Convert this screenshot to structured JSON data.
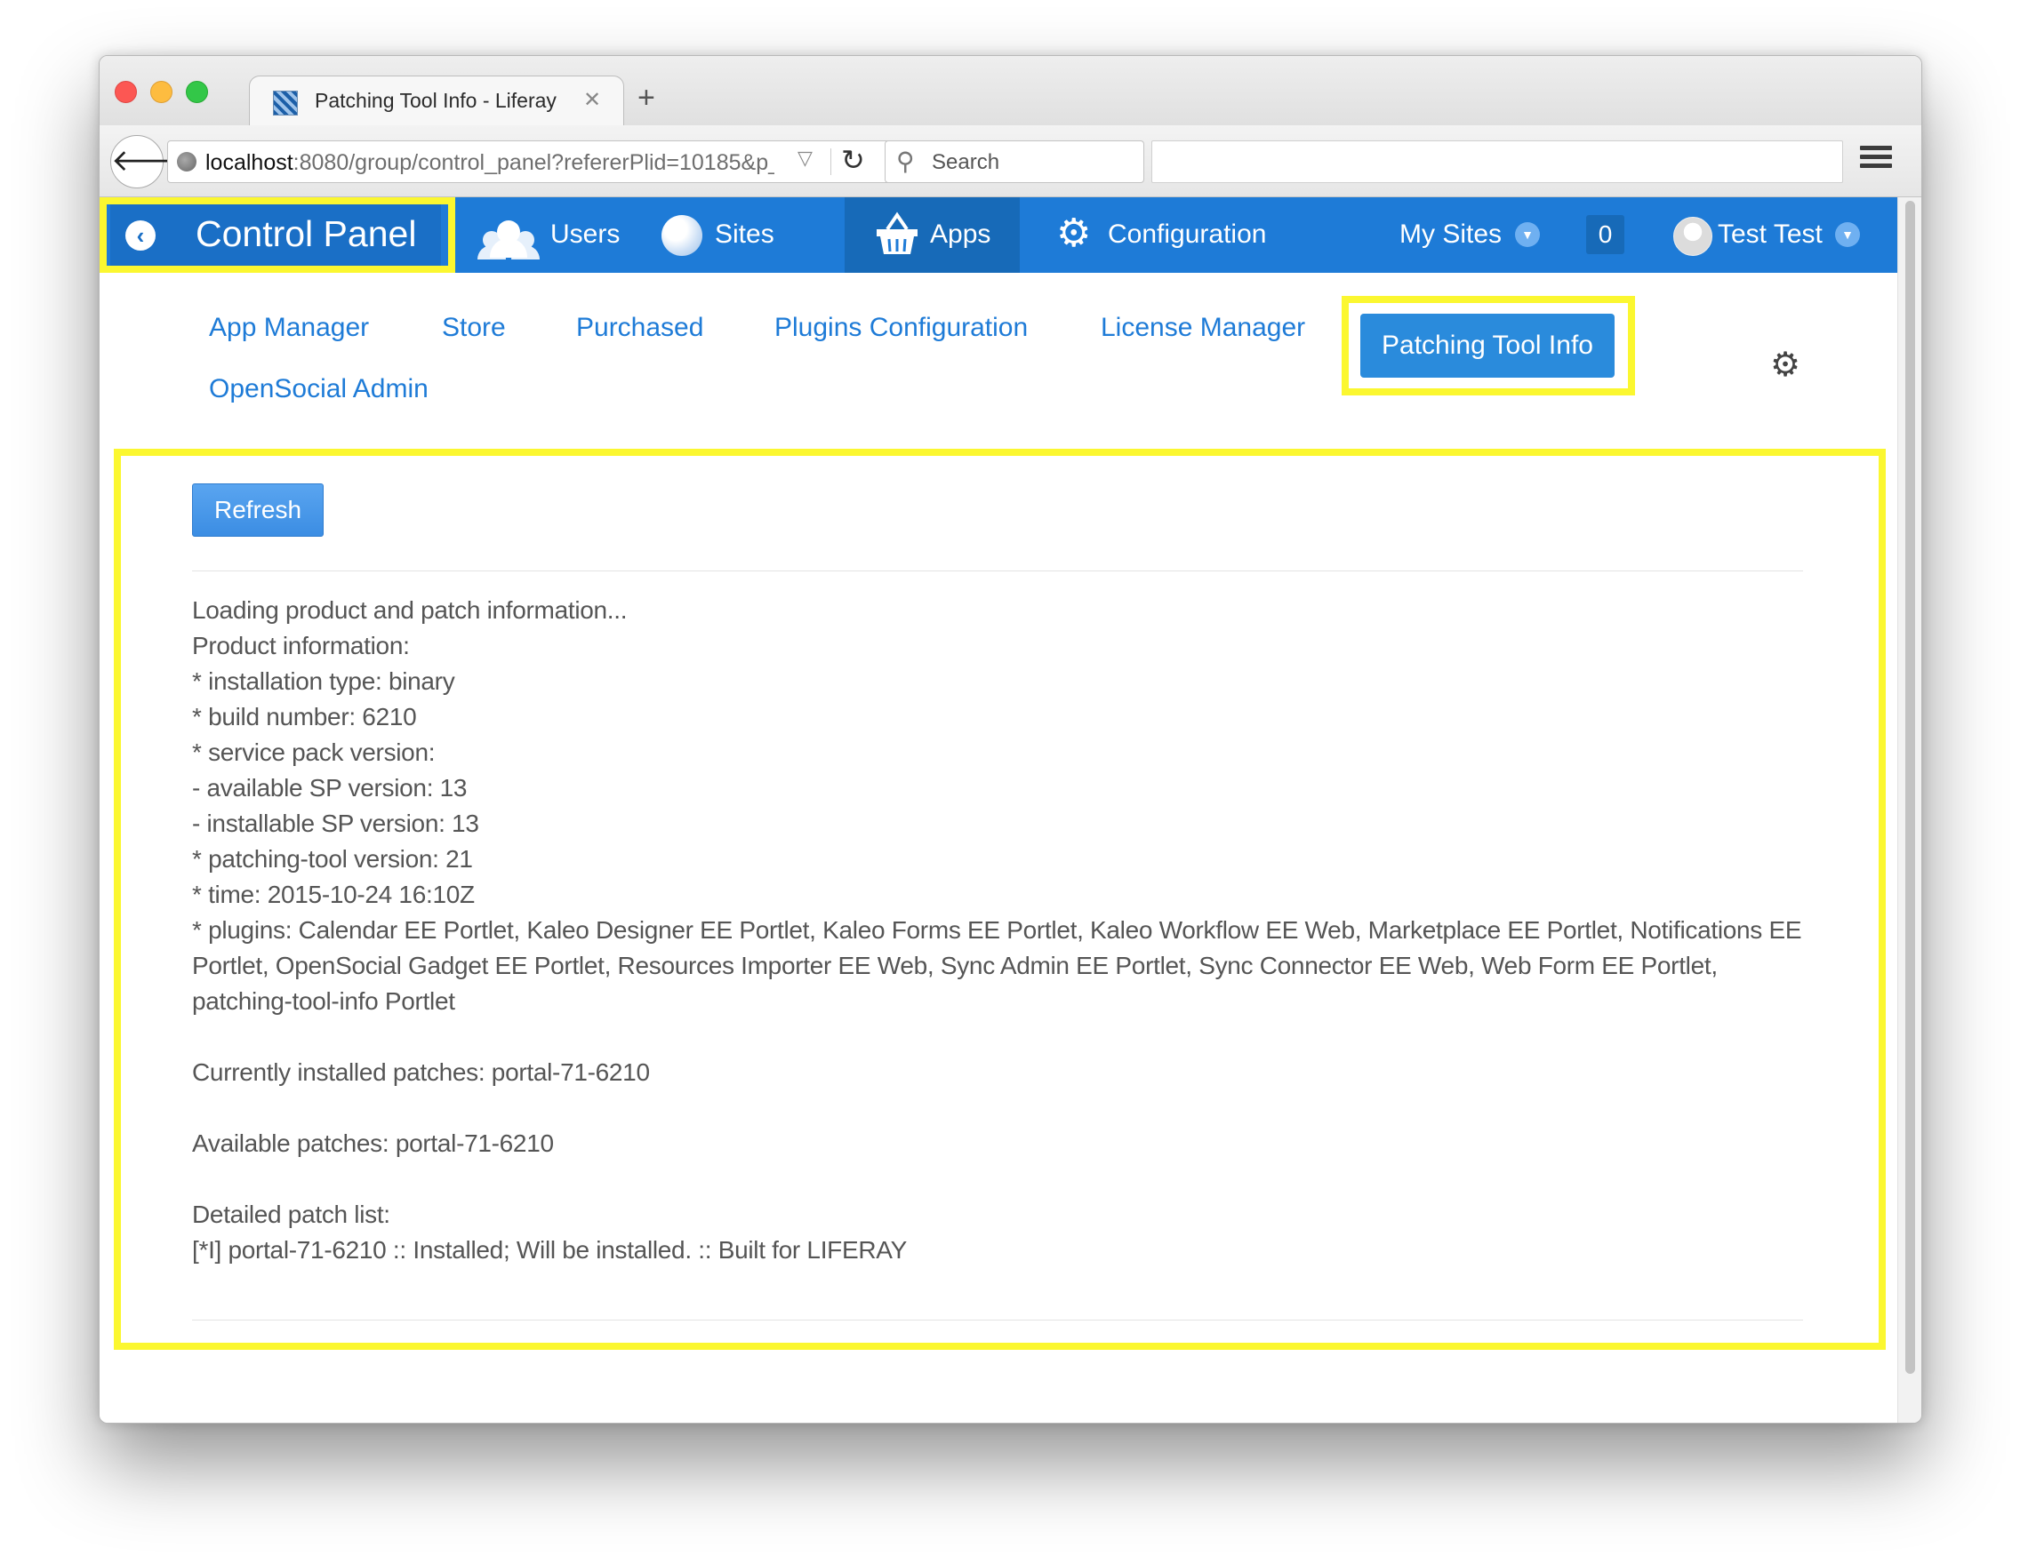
{
  "browser": {
    "tab_title": "Patching Tool Info - Liferay",
    "url_host": "localhost",
    "url_rest": ":8080/group/control_panel?refererPlid=10185&p_p",
    "search_placeholder": "Search"
  },
  "dockbar": {
    "control_panel": "Control Panel",
    "items": [
      {
        "label": "Users",
        "icon": "users-icon"
      },
      {
        "label": "Sites",
        "icon": "globe-icon"
      },
      {
        "label": "Apps",
        "icon": "basket-icon"
      },
      {
        "label": "Configuration",
        "icon": "gear-icon"
      }
    ],
    "my_sites": "My Sites",
    "notifications": "0",
    "user_name": "Test Test",
    "accent_color": "#1e7bd7",
    "highlight_color": "#fbf730"
  },
  "nav": {
    "tabs": [
      "App Manager",
      "Store",
      "Purchased",
      "Plugins Configuration",
      "License Manager",
      "Patching Tool Info",
      "OpenSocial Admin"
    ],
    "active": "Patching Tool Info"
  },
  "content": {
    "refresh_label": "Refresh",
    "lines": [
      "Loading product and patch information...",
      "Product information:",
      "* installation type: binary",
      "* build number: 6210",
      "* service pack version:",
      "- available SP version: 13",
      "- installable SP version: 13",
      "* patching-tool version: 21",
      "* time: 2015-10-24 16:10Z"
    ],
    "plugins": "* plugins: Calendar EE Portlet, Kaleo Designer EE Portlet, Kaleo Forms EE Portlet, Kaleo Workflow EE Web, Marketplace EE Portlet, Notifications EE Portlet, OpenSocial Gadget EE Portlet, Resources Importer EE Web, Sync Admin EE Portlet, Sync Connector EE Web, Web Form EE Portlet, patching-tool-info Portlet",
    "installed_patches": "Currently installed patches: portal-71-6210",
    "available_patches": "Available patches: portal-71-6210",
    "detailed_header": "Detailed patch list:",
    "detailed_item": "[*I] portal-71-6210 :: Installed; Will be installed. :: Built for LIFERAY"
  }
}
